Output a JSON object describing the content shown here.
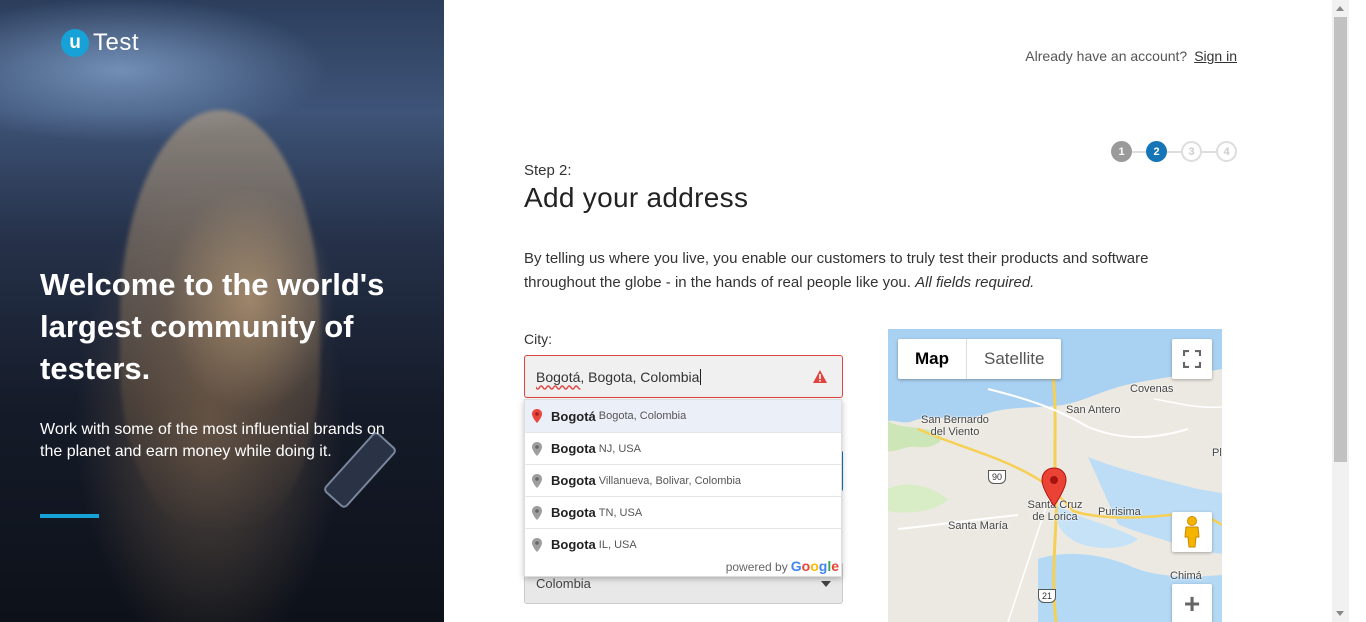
{
  "brand": {
    "badge": "u",
    "name": "Test",
    "accent": "#16a2d7"
  },
  "hero": {
    "title": "Welcome to the world's largest community of testers.",
    "subtitle": "Work with some of the most influential brands on the planet and earn money while doing it."
  },
  "header": {
    "account_prompt": "Already have an account?",
    "sign_in": "Sign in"
  },
  "steps": {
    "items": [
      "1",
      "2",
      "3",
      "4"
    ],
    "current": 2,
    "active_color": "#1476b6"
  },
  "form": {
    "step_label": "Step 2:",
    "title": "Add your address",
    "intro_text": "By telling us where you live, you enable our customers to truly test their products and software throughout the globe - in the hands of real people like you.",
    "intro_emphasis": "All fields required.",
    "city_label": "City:",
    "city_value_typed": "Bogotá",
    "city_value_rest": ", Bogota, Colombia",
    "country_value": "Colombia",
    "error_color": "#e1443f"
  },
  "autocomplete": {
    "items": [
      {
        "main": "Bogotá",
        "secondary": "Bogota, Colombia",
        "icon": "red-map-pin-icon"
      },
      {
        "main": "Bogota",
        "secondary": "NJ, USA",
        "icon": "map-pin-icon"
      },
      {
        "main": "Bogota",
        "secondary": "Villanueva, Bolivar, Colombia",
        "icon": "map-pin-icon"
      },
      {
        "main": "Bogota",
        "secondary": "TN, USA",
        "icon": "map-pin-icon"
      },
      {
        "main": "Bogota",
        "secondary": "IL, USA",
        "icon": "map-pin-icon"
      }
    ],
    "powered_by": "powered by",
    "google": [
      "G",
      "o",
      "o",
      "g",
      "l",
      "e"
    ]
  },
  "map": {
    "type_options": [
      "Map",
      "Satellite"
    ],
    "selected_type": "Map",
    "places": [
      "Covenas",
      "San Antero",
      "San Bernardo del Viento",
      "Santa Cruz de Lorica",
      "Purisima",
      "Santa María",
      "Pl",
      "Chimá"
    ],
    "road_shields": [
      "90",
      "21"
    ],
    "zoom_in": "+"
  }
}
